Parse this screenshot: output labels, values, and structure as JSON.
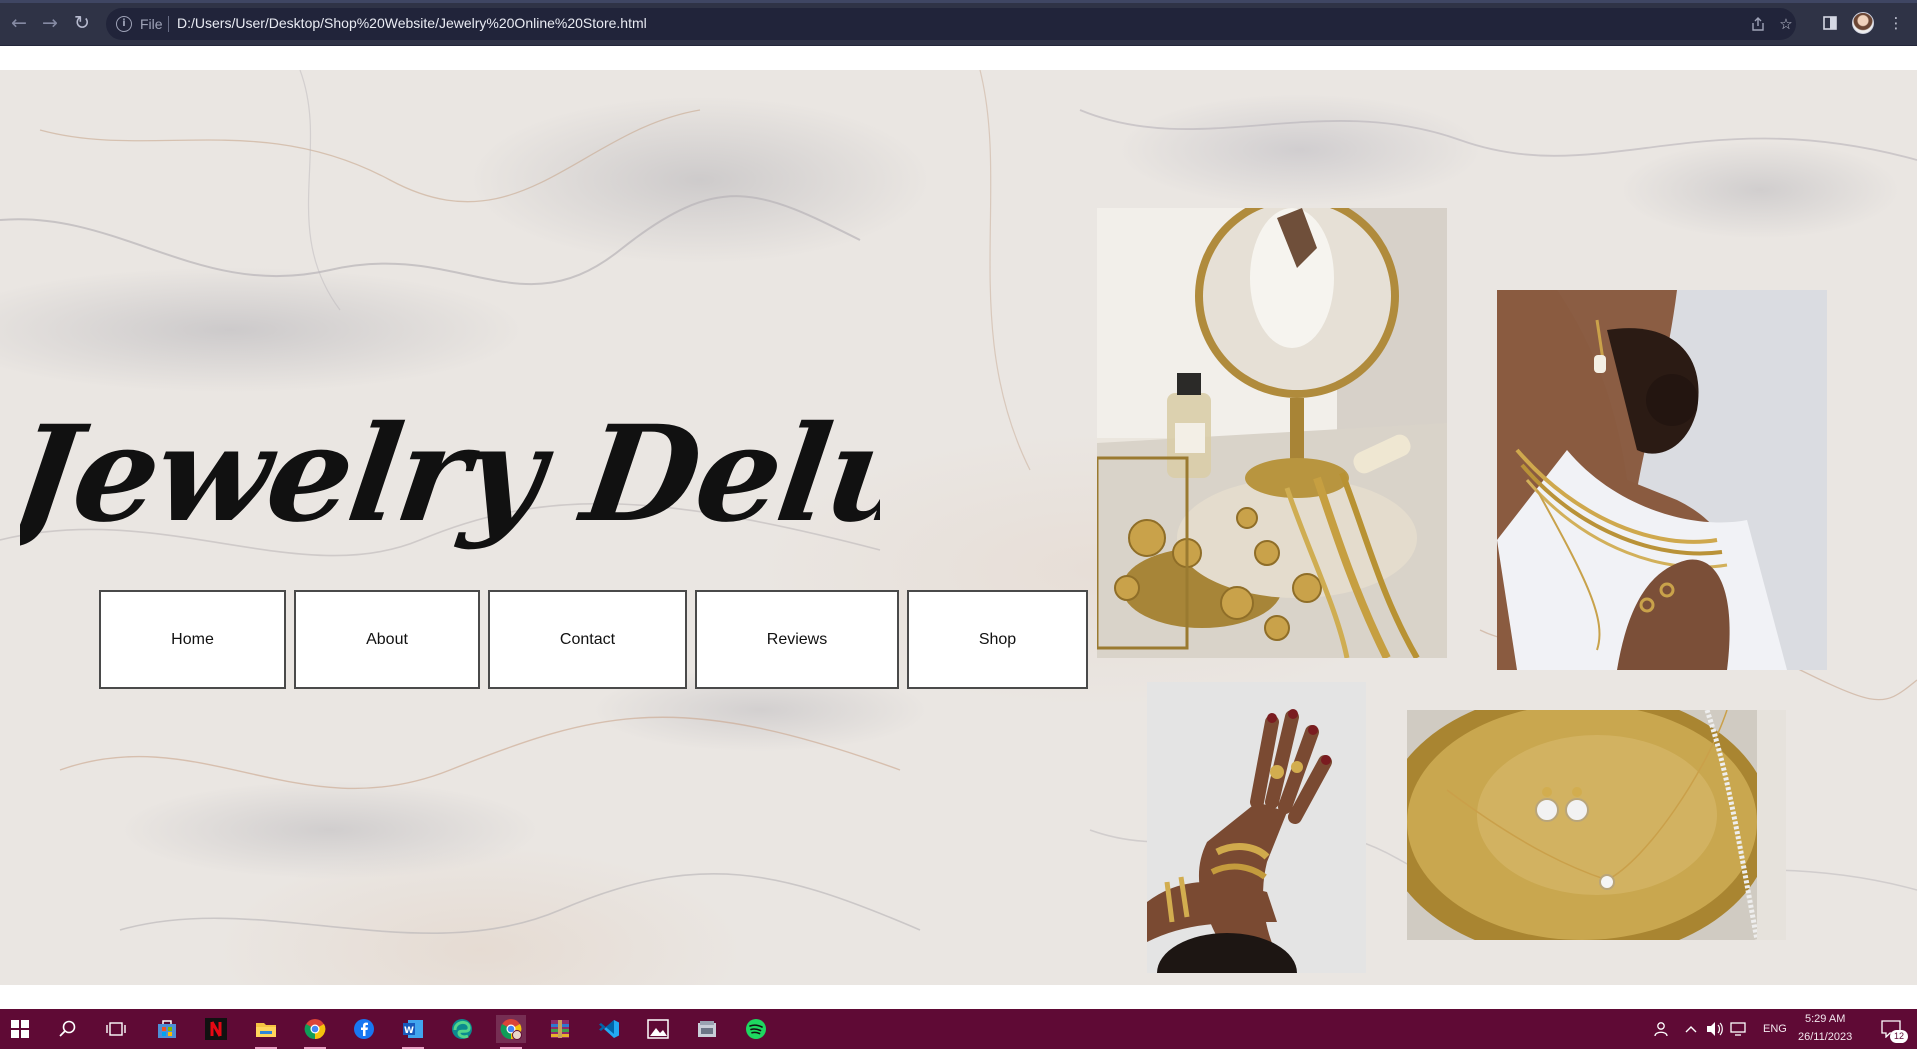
{
  "browser": {
    "address": {
      "scheme_label": "File",
      "url": "D:/Users/User/Desktop/Shop%20Website/Jewelry%20Online%20Store.html"
    },
    "icons": [
      "back-arrow-icon",
      "forward-arrow-icon",
      "reload-icon",
      "info-icon",
      "share-icon",
      "star-icon",
      "sidebar-icon",
      "profile-avatar",
      "kebab-menu-icon"
    ]
  },
  "site": {
    "title": "Jewelry Deluxe",
    "nav": [
      {
        "label": "Home"
      },
      {
        "label": "About"
      },
      {
        "label": "Contact"
      },
      {
        "label": "Reviews"
      },
      {
        "label": "Shop"
      }
    ],
    "photos": [
      "vanity-mirror-jewelry-photo",
      "layered-necklaces-photo",
      "hand-rings-bracelets-photo",
      "gold-dish-earrings-photo"
    ]
  },
  "taskbar": {
    "apps": [
      "start-icon",
      "search-icon",
      "task-view-icon",
      "store-icon",
      "netflix-icon",
      "file-explorer-icon",
      "chrome-icon",
      "facebook-icon",
      "word-icon",
      "edge-icon",
      "chrome-profile-icon",
      "winrar-icon",
      "vscode-icon",
      "photos-icon",
      "app-icon",
      "spotify-icon"
    ],
    "tray": {
      "language": "ENG",
      "time": "5:29 AM",
      "date": "26/11/2023",
      "notifications": "12"
    }
  },
  "colors": {
    "chrome_bg": "#2f3346",
    "taskbar_bg": "#5f0a35",
    "nav_border": "#4a4a4a",
    "title_color": "#111111"
  }
}
